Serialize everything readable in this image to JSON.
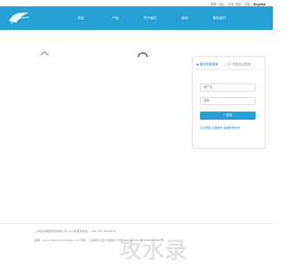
{
  "toplinks": {
    "items": [
      "郎快 | 西山 | 分地",
      "密急 | 注册 |"
    ],
    "lang": "English"
  },
  "nav": {
    "items": [
      "首页",
      "产品",
      "关于我们",
      "案例",
      "联系我们"
    ]
  },
  "login": {
    "tab_active": "账号密码登录",
    "tab_other": "CE 短信验证登录",
    "username_placeholder": "用户名",
    "password_placeholder": "密码",
    "submit_label": "• 登录",
    "help_text": "忘记密码 注册账号  其他登录方式"
  },
  "footer": {
    "line1": "上海某某网络科技有限公司    24小时服务电话 : +86 021-5874833",
    "line2": "邮箱 : service@hemmerlogis.com   地址 : 上海市虹口区大连路2079号2095室   沪ICP备2020205897号"
  },
  "watermark": "攻水录",
  "colors": {
    "brand": "#25a0d6"
  }
}
